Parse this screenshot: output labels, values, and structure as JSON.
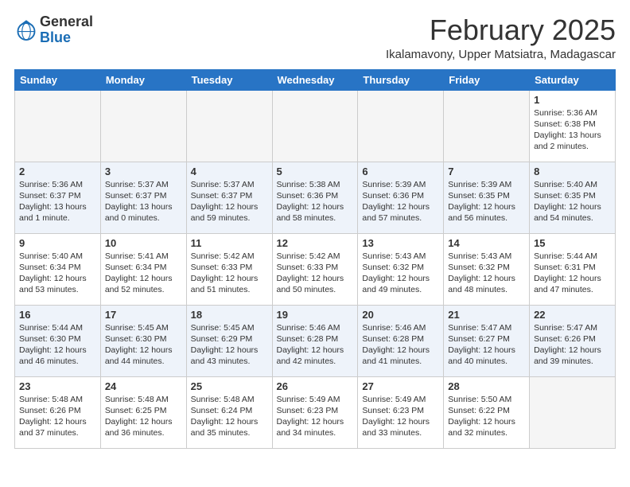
{
  "logo": {
    "general": "General",
    "blue": "Blue"
  },
  "title": "February 2025",
  "location": "Ikalamavony, Upper Matsiatra, Madagascar",
  "weekdays": [
    "Sunday",
    "Monday",
    "Tuesday",
    "Wednesday",
    "Thursday",
    "Friday",
    "Saturday"
  ],
  "weeks": [
    [
      {
        "day": "",
        "info": ""
      },
      {
        "day": "",
        "info": ""
      },
      {
        "day": "",
        "info": ""
      },
      {
        "day": "",
        "info": ""
      },
      {
        "day": "",
        "info": ""
      },
      {
        "day": "",
        "info": ""
      },
      {
        "day": "1",
        "info": "Sunrise: 5:36 AM\nSunset: 6:38 PM\nDaylight: 13 hours\nand 2 minutes."
      }
    ],
    [
      {
        "day": "2",
        "info": "Sunrise: 5:36 AM\nSunset: 6:37 PM\nDaylight: 13 hours\nand 1 minute."
      },
      {
        "day": "3",
        "info": "Sunrise: 5:37 AM\nSunset: 6:37 PM\nDaylight: 13 hours\nand 0 minutes."
      },
      {
        "day": "4",
        "info": "Sunrise: 5:37 AM\nSunset: 6:37 PM\nDaylight: 12 hours\nand 59 minutes."
      },
      {
        "day": "5",
        "info": "Sunrise: 5:38 AM\nSunset: 6:36 PM\nDaylight: 12 hours\nand 58 minutes."
      },
      {
        "day": "6",
        "info": "Sunrise: 5:39 AM\nSunset: 6:36 PM\nDaylight: 12 hours\nand 57 minutes."
      },
      {
        "day": "7",
        "info": "Sunrise: 5:39 AM\nSunset: 6:35 PM\nDaylight: 12 hours\nand 56 minutes."
      },
      {
        "day": "8",
        "info": "Sunrise: 5:40 AM\nSunset: 6:35 PM\nDaylight: 12 hours\nand 54 minutes."
      }
    ],
    [
      {
        "day": "9",
        "info": "Sunrise: 5:40 AM\nSunset: 6:34 PM\nDaylight: 12 hours\nand 53 minutes."
      },
      {
        "day": "10",
        "info": "Sunrise: 5:41 AM\nSunset: 6:34 PM\nDaylight: 12 hours\nand 52 minutes."
      },
      {
        "day": "11",
        "info": "Sunrise: 5:42 AM\nSunset: 6:33 PM\nDaylight: 12 hours\nand 51 minutes."
      },
      {
        "day": "12",
        "info": "Sunrise: 5:42 AM\nSunset: 6:33 PM\nDaylight: 12 hours\nand 50 minutes."
      },
      {
        "day": "13",
        "info": "Sunrise: 5:43 AM\nSunset: 6:32 PM\nDaylight: 12 hours\nand 49 minutes."
      },
      {
        "day": "14",
        "info": "Sunrise: 5:43 AM\nSunset: 6:32 PM\nDaylight: 12 hours\nand 48 minutes."
      },
      {
        "day": "15",
        "info": "Sunrise: 5:44 AM\nSunset: 6:31 PM\nDaylight: 12 hours\nand 47 minutes."
      }
    ],
    [
      {
        "day": "16",
        "info": "Sunrise: 5:44 AM\nSunset: 6:30 PM\nDaylight: 12 hours\nand 46 minutes."
      },
      {
        "day": "17",
        "info": "Sunrise: 5:45 AM\nSunset: 6:30 PM\nDaylight: 12 hours\nand 44 minutes."
      },
      {
        "day": "18",
        "info": "Sunrise: 5:45 AM\nSunset: 6:29 PM\nDaylight: 12 hours\nand 43 minutes."
      },
      {
        "day": "19",
        "info": "Sunrise: 5:46 AM\nSunset: 6:28 PM\nDaylight: 12 hours\nand 42 minutes."
      },
      {
        "day": "20",
        "info": "Sunrise: 5:46 AM\nSunset: 6:28 PM\nDaylight: 12 hours\nand 41 minutes."
      },
      {
        "day": "21",
        "info": "Sunrise: 5:47 AM\nSunset: 6:27 PM\nDaylight: 12 hours\nand 40 minutes."
      },
      {
        "day": "22",
        "info": "Sunrise: 5:47 AM\nSunset: 6:26 PM\nDaylight: 12 hours\nand 39 minutes."
      }
    ],
    [
      {
        "day": "23",
        "info": "Sunrise: 5:48 AM\nSunset: 6:26 PM\nDaylight: 12 hours\nand 37 minutes."
      },
      {
        "day": "24",
        "info": "Sunrise: 5:48 AM\nSunset: 6:25 PM\nDaylight: 12 hours\nand 36 minutes."
      },
      {
        "day": "25",
        "info": "Sunrise: 5:48 AM\nSunset: 6:24 PM\nDaylight: 12 hours\nand 35 minutes."
      },
      {
        "day": "26",
        "info": "Sunrise: 5:49 AM\nSunset: 6:23 PM\nDaylight: 12 hours\nand 34 minutes."
      },
      {
        "day": "27",
        "info": "Sunrise: 5:49 AM\nSunset: 6:23 PM\nDaylight: 12 hours\nand 33 minutes."
      },
      {
        "day": "28",
        "info": "Sunrise: 5:50 AM\nSunset: 6:22 PM\nDaylight: 12 hours\nand 32 minutes."
      },
      {
        "day": "",
        "info": ""
      }
    ]
  ]
}
